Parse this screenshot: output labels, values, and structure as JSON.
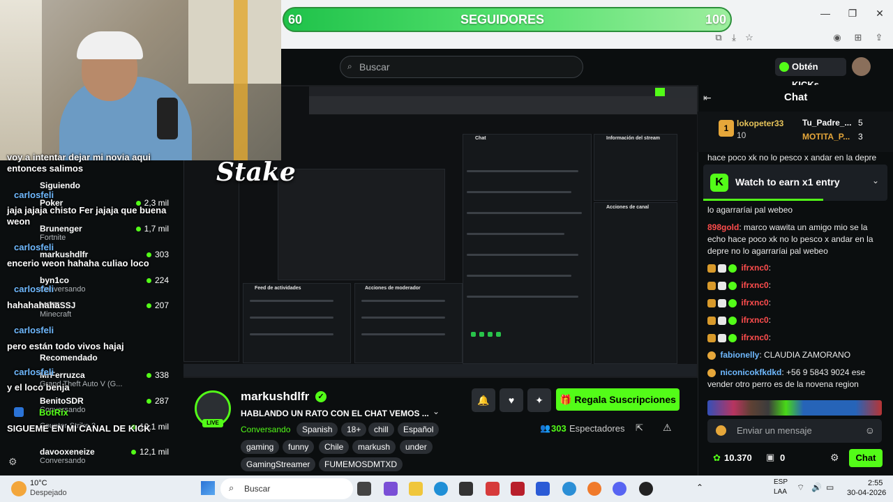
{
  "follow_goal": {
    "current": "60",
    "label": "SEGUIDORES",
    "target": "100",
    "progress": 0.6
  },
  "header": {
    "search_placeholder": "Buscar",
    "kicks_label": "Obtén KICKs"
  },
  "webcam_overlay": {
    "stake_logo": "Stake",
    "messages": [
      {
        "user": "",
        "text": "voy a intentar dejar mi novia aqui entonces salimos"
      },
      {
        "user": "carlosfeli",
        "text": "jaja jajaja chisto Fer jajaja que buena weon"
      },
      {
        "user": "carlosfeli",
        "text": "encerio weon hahaha culiao loco"
      },
      {
        "user": "carlosfeli",
        "text": "hahahahaha"
      },
      {
        "user": "carlosfeli",
        "text": "pero están todo vivos hajaj"
      },
      {
        "user": "carlosfeli",
        "text": "y el loco benja"
      },
      {
        "user": "BotRix",
        "text": "SIGUEME EN MI CANAL DE KICK"
      }
    ]
  },
  "sidebar": {
    "following_title": "Siguiendo",
    "recommended_title": "Recomendado",
    "items": [
      {
        "name": "Poker",
        "game": "",
        "viewers": "2,3 mil"
      },
      {
        "name": "Brunenger",
        "game": "Fortnite",
        "viewers": "1,7 mil"
      },
      {
        "name": "markushdlfr",
        "game": "",
        "viewers": "303"
      },
      {
        "name": "byn1co",
        "game": "Conversando",
        "viewers": "224"
      },
      {
        "name": "MITESSJ",
        "game": "Minecraft",
        "viewers": "207"
      },
      {
        "name": "MrFerruzca",
        "game": "Grand Theft Auto V (G...",
        "viewers": "338"
      },
      {
        "name": "BenitoSDR",
        "game": "Conversando",
        "viewers": "287"
      },
      {
        "name": "",
        "game": "Counter-Strike 2",
        "viewers": "13,1 mil"
      },
      {
        "name": "davooxeneize",
        "game": "Conversando",
        "viewers": "12,1 mil"
      }
    ]
  },
  "stream_info": {
    "streamer": "markushdlfr",
    "live_label": "LIVE",
    "title": "HABLANDO UN RATO CON EL CHAT VEMOS ...",
    "category": "Conversando",
    "tags": [
      "Spanish",
      "18+",
      "chill",
      "Español",
      "gaming",
      "funny",
      "Chile",
      "markush",
      "under",
      "GamingStreamer",
      "FUMEMOSDMTXD"
    ],
    "viewers": "303",
    "viewers_label": "Espectadores",
    "subs_button": "Regala Suscripciones"
  },
  "chat": {
    "title": "Chat",
    "leaderboard": [
      {
        "rank": "1",
        "user": "lokopeter33",
        "count": "10"
      },
      {
        "user": "Tu_Padre_...",
        "count": "5"
      },
      {
        "user": "MOTITA_P...",
        "count": "3"
      }
    ],
    "earn_banner": "Watch to earn x1 entry",
    "partial_message": "hace poco xk no lo pesco x andar en la depre no lo agarraríai pal webeo",
    "messages": [
      {
        "user": "898gold",
        "text": "marco wawita un amigo mio se la echo hace poco xk no lo pesco x andar en la depre no lo agarraríai pal webeo",
        "color": "#ff4d4d"
      },
      {
        "user": "ifrxnc0",
        "text": "",
        "color": "#ff4d4d"
      },
      {
        "user": "ifrxnc0",
        "text": "",
        "color": "#ff4d4d"
      },
      {
        "user": "ifrxnc0",
        "text": "",
        "color": "#ff4d4d"
      },
      {
        "user": "ifrxnc0",
        "text": "",
        "color": "#ff4d4d"
      },
      {
        "user": "ifrxnc0",
        "text": "",
        "color": "#ff4d4d"
      },
      {
        "user": "fabionelly",
        "text": "CLAUDIA ZAMORANO",
        "color": "#6fb9ff"
      },
      {
        "user": "niconicokfkdkd",
        "text": "+56 9 5843 9024 ese vender otro perro es de la novena region",
        "color": "#6fb9ff"
      }
    ],
    "input_placeholder": "Enviar un mensaje",
    "points": "10.370",
    "items_count": "0",
    "send_label": "Chat"
  },
  "taskbar": {
    "temperature": "10°C",
    "weather": "Despejado",
    "search_label": "Buscar",
    "lang_top": "ESP",
    "lang_bottom": "LAA",
    "time": "2:55",
    "date": "30-04-2026"
  },
  "colors": {
    "kick_green": "#53fc18",
    "chat_red": "#ff4d4d",
    "link_blue": "#6fb9ff"
  }
}
